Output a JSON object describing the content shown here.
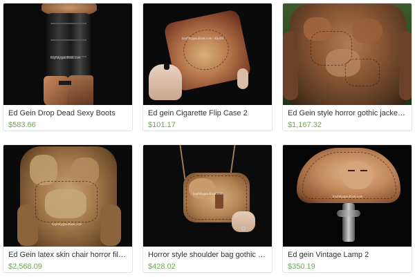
{
  "listings": [
    {
      "title": "Ed Gein Drop Dead Sexy Boots",
      "price": "$583.66",
      "thumb_icon": "boots-image"
    },
    {
      "title": "Ed gein Cigarette Flip Case 2",
      "price": "$101.17",
      "thumb_icon": "flip-case-image"
    },
    {
      "title": "Ed Gein style horror gothic jacket Hall...",
      "price": "$1,167.32",
      "thumb_icon": "jacket-image"
    },
    {
      "title": "Ed Gein latex skin chair horror film pr...",
      "price": "$2,568.09",
      "thumb_icon": "chair-image"
    },
    {
      "title": "Horror style shoulder bag gothic stra...",
      "price": "$428.02",
      "thumb_icon": "shoulder-bag-image"
    },
    {
      "title": "Ed gein Vintage Lamp 2",
      "price": "$350.19",
      "thumb_icon": "lamp-image"
    }
  ],
  "colors": {
    "price_green": "#6aa84f",
    "title_text": "#333333",
    "card_border": "#e3e3e3"
  }
}
